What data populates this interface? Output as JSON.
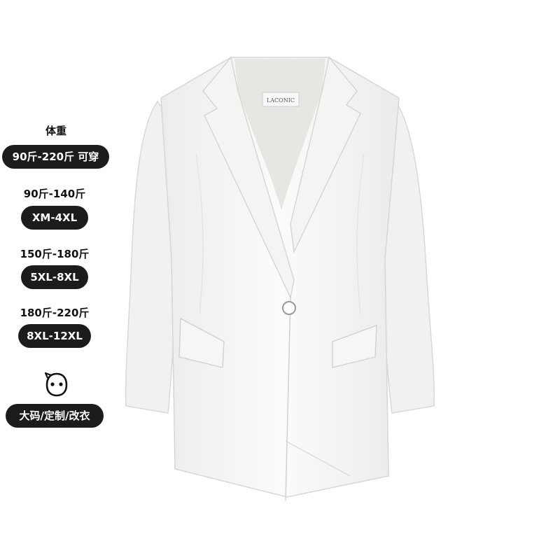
{
  "size_panel": {
    "weight_heading": "体重",
    "weight_range": "90斤-220斤 可穿",
    "tiers": [
      {
        "weight": "90斤-140斤",
        "size": "XM-4XL"
      },
      {
        "weight": "150斤-180斤",
        "size": "5XL-8XL"
      },
      {
        "weight": "180斤-220斤",
        "size": "8XL-12XL"
      }
    ],
    "mascot_icon": "round-face-icon",
    "service_label": "大码/定制/改衣"
  },
  "product": {
    "brand_tag": "LACONIC",
    "item": "white-blazer"
  },
  "colors": {
    "pill_bg": "#1c1c1c",
    "jacket": "#f7f7f5"
  }
}
